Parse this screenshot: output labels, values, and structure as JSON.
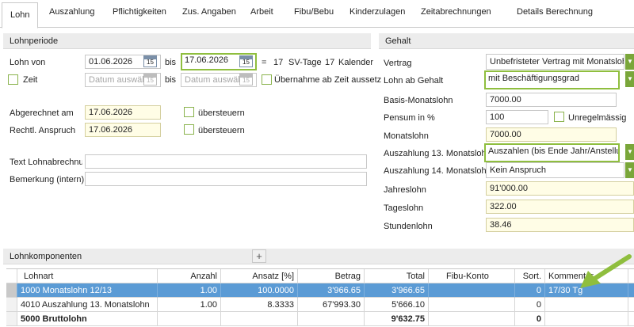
{
  "tabs": [
    "Lohn",
    "Auszahlung",
    "Pflichtigkeiten",
    "Zus. Angaben",
    "Arbeit",
    "Fibu/Bebu",
    "Kinderzulagen",
    "Zeitabrechnungen",
    "Details Berechnung"
  ],
  "lohnperiode": {
    "header": "Lohnperiode",
    "lohn_von_label": "Lohn von",
    "lohn_von_value": "01.06.2026",
    "bis1": "bis",
    "lohn_bis_value": "17.06.2026",
    "equals": "=",
    "sv_days": "17",
    "sv_label": "SV-Tage",
    "kal_days": "17",
    "kal_label": "Kalender",
    "zeit_label": "Zeit",
    "datum_placeholder": "Datum auswähl",
    "bis2": "bis",
    "uebernahme_label": "Übernahme ab Zeit aussetz",
    "cal_glyph": "15",
    "abgerechnet_label": "Abgerechnet am",
    "abgerechnet_value": "17.06.2026",
    "uebersteuern1": "übersteuern",
    "anspruch_label": "Rechtl. Anspruch",
    "anspruch_value": "17.06.2026",
    "uebersteuern2": "übersteuern",
    "text_label": "Text Lohnabrechnung",
    "text_value": "",
    "bemerkung_label": "Bemerkung (intern)",
    "bemerkung_value": ""
  },
  "gehalt": {
    "header": "Gehalt",
    "vertrag_label": "Vertrag",
    "vertrag_value": "Unbefristeter Vertrag mit Monatslohn",
    "lohn_ab_label": "Lohn ab Gehalt",
    "lohn_ab_value": "mit Beschäftigungsgrad",
    "basis_label": "Basis-Monatslohn",
    "basis_value": "7000.00",
    "pensum_label": "Pensum in %",
    "pensum_value": "100",
    "unregel_label": "Unregelmässig",
    "monatslohn_label": "Monatslohn",
    "monatslohn_value": "7000.00",
    "ausz13_label": "Auszahlung 13. Monatslohn",
    "ausz13_value": "Auszahlen (bis Ende Jahr/Anstellung)",
    "ausz14_label": "Auszahlung 14. Monatslohn",
    "ausz14_value": "Kein Anspruch",
    "jahreslohn_label": "Jahreslohn",
    "jahreslohn_value": "91'000.00",
    "tageslohn_label": "Tageslohn",
    "tageslohn_value": "322.00",
    "stundenlohn_label": "Stundenlohn",
    "stundenlohn_value": "38.46",
    "drop_glyph": "▼"
  },
  "lohnkomponenten": {
    "header": "Lohnkomponenten",
    "add_glyph": "+",
    "columns": [
      "Lohnart",
      "Anzahl",
      "Ansatz [%]",
      "Betrag",
      "Total",
      "Fibu-Konto",
      "Sort.",
      "Kommentar"
    ],
    "rows": [
      [
        "1000 Monatslohn 12/13",
        "1.00",
        "100.0000",
        "3'966.65",
        "3'966.65",
        "",
        "0",
        "17/30 Tg"
      ],
      [
        "4010 Auszahlung 13. Monatslohn",
        "1.00",
        "8.3333",
        "67'993.30",
        "5'666.10",
        "",
        "0",
        ""
      ],
      [
        "5000 Bruttolohn",
        "",
        "",
        "",
        "9'632.75",
        "",
        "0",
        ""
      ]
    ]
  },
  "colors": {
    "accent_green": "#8fbe3e",
    "selected_row": "#5b9bd5",
    "field_yellow": "#fffde6"
  }
}
